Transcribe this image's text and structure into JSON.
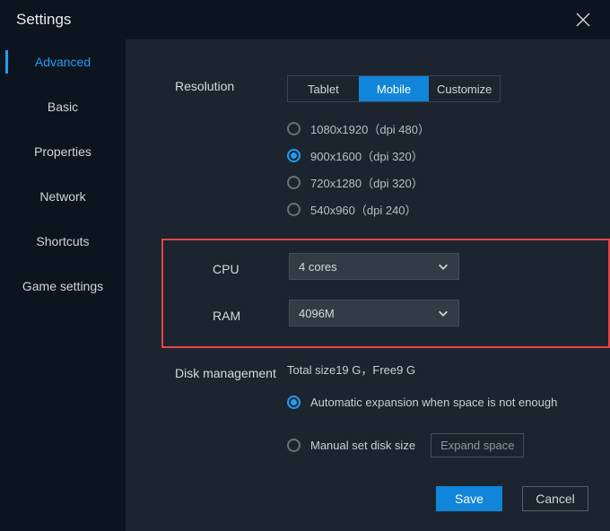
{
  "title": "Settings",
  "sidebar": {
    "items": [
      {
        "label": "Advanced",
        "active": true
      },
      {
        "label": "Basic",
        "active": false
      },
      {
        "label": "Properties",
        "active": false
      },
      {
        "label": "Network",
        "active": false
      },
      {
        "label": "Shortcuts",
        "active": false
      },
      {
        "label": "Game settings",
        "active": false
      }
    ]
  },
  "resolution": {
    "label": "Resolution",
    "tabs": [
      {
        "label": "Tablet",
        "active": false
      },
      {
        "label": "Mobile",
        "active": true
      },
      {
        "label": "Customize",
        "active": false
      }
    ],
    "options": [
      {
        "label": "1080x1920（dpi 480）",
        "selected": false
      },
      {
        "label": "900x1600（dpi 320）",
        "selected": true
      },
      {
        "label": "720x1280（dpi 320）",
        "selected": false
      },
      {
        "label": "540x960（dpi 240）",
        "selected": false
      }
    ]
  },
  "cpu": {
    "label": "CPU",
    "value": "4 cores"
  },
  "ram": {
    "label": "RAM",
    "value": "4096M"
  },
  "disk": {
    "label": "Disk management",
    "info": "Total size19 G，Free9 G",
    "opt_auto": {
      "label": "Automatic expansion when space is not enough",
      "selected": true
    },
    "opt_manual": {
      "label": "Manual set disk size",
      "selected": false
    },
    "expand_label": "Expand space"
  },
  "footer": {
    "save": "Save",
    "cancel": "Cancel"
  }
}
